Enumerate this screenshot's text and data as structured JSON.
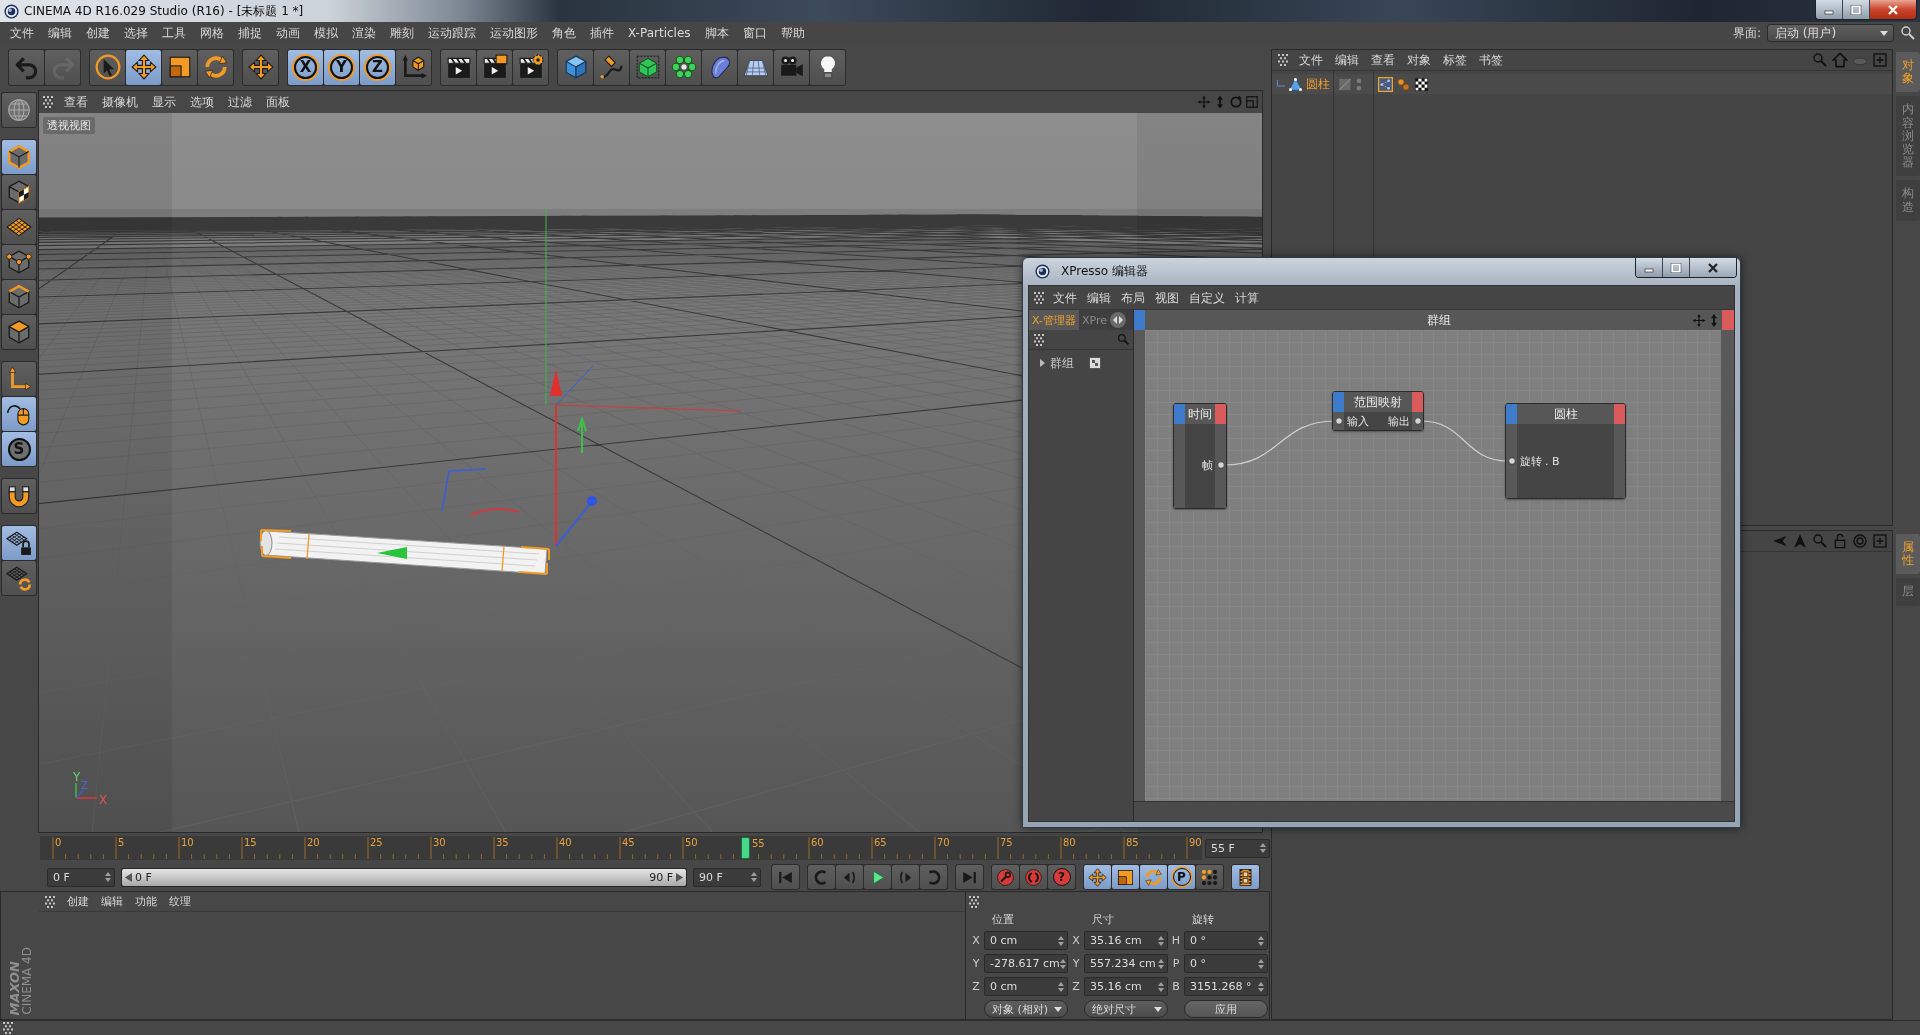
{
  "title_bar": {
    "title": "CINEMA 4D R16.029 Studio (R16) - [未标题 1 *]"
  },
  "menu_bar": {
    "items": [
      "文件",
      "编辑",
      "创建",
      "选择",
      "工具",
      "网格",
      "捕捉",
      "动画",
      "模拟",
      "渲染",
      "雕刻",
      "运动跟踪",
      "运动图形",
      "角色",
      "插件",
      "X-Particles",
      "脚本",
      "窗口",
      "帮助"
    ],
    "layout_label": "界面:",
    "layout_value": "启动 (用户)"
  },
  "toolbar": {
    "groups": [
      {
        "items": [
          {
            "kind": "undo",
            "on": false,
            "disabled": false
          },
          {
            "kind": "redo",
            "on": false,
            "disabled": true
          }
        ]
      },
      {
        "items": [
          {
            "kind": "select",
            "on": false,
            "disabled": false
          },
          {
            "kind": "move",
            "on": true,
            "disabled": false
          },
          {
            "kind": "scale",
            "on": false,
            "disabled": false
          },
          {
            "kind": "rotate",
            "on": false,
            "disabled": false
          }
        ]
      },
      {
        "items": [
          {
            "kind": "cross",
            "on": false,
            "disabled": false
          }
        ]
      },
      {
        "items": [
          {
            "kind": "axislock",
            "label": "X",
            "on": true,
            "disabled": false
          },
          {
            "kind": "axislock",
            "label": "Y",
            "on": true,
            "disabled": false
          },
          {
            "kind": "axislock",
            "label": "Z",
            "on": true,
            "disabled": false
          },
          {
            "kind": "coords",
            "on": false,
            "disabled": false
          }
        ]
      },
      {
        "items": [
          {
            "kind": "render",
            "on": false,
            "disabled": false
          },
          {
            "kind": "renderview",
            "on": false,
            "disabled": false
          },
          {
            "kind": "rendersettings",
            "on": false,
            "disabled": false
          }
        ]
      },
      {
        "items": [
          {
            "kind": "cube",
            "on": false,
            "disabled": false
          },
          {
            "kind": "pen",
            "on": false,
            "disabled": false
          },
          {
            "kind": "subdiv",
            "on": false,
            "disabled": false
          },
          {
            "kind": "cloner",
            "on": false,
            "disabled": false
          },
          {
            "kind": "bend",
            "on": false,
            "disabled": false
          },
          {
            "kind": "floor",
            "on": false,
            "disabled": false
          },
          {
            "kind": "camera",
            "on": false,
            "disabled": false
          },
          {
            "kind": "light",
            "on": false,
            "disabled": false
          }
        ]
      }
    ]
  },
  "tool_palette": {
    "groups": [
      {
        "items": [
          {
            "kind": "globe",
            "on": false
          }
        ]
      },
      {
        "items": [
          {
            "kind": "model",
            "on": true
          },
          {
            "kind": "texture",
            "on": false
          },
          {
            "kind": "workplane",
            "on": false
          },
          {
            "kind": "points",
            "on": false
          },
          {
            "kind": "edges",
            "on": false
          },
          {
            "kind": "polygons",
            "on": false
          }
        ]
      },
      {
        "items": [
          {
            "kind": "axis",
            "on": false
          },
          {
            "kind": "tweak",
            "on": true
          },
          {
            "kind": "solo",
            "label": "S",
            "on": true
          }
        ]
      },
      {
        "items": [
          {
            "kind": "magnet",
            "on": false
          }
        ]
      },
      {
        "items": [
          {
            "kind": "snaplock",
            "on": true
          },
          {
            "kind": "snaprotate",
            "on": false
          }
        ]
      }
    ]
  },
  "viewport": {
    "menu": [
      "查看",
      "摄像机",
      "显示",
      "选项",
      "过滤",
      "面板"
    ],
    "label": "透视视图",
    "axis_labels": [
      "Y",
      "Z",
      "X"
    ]
  },
  "timeline": {
    "ticks": [
      "0",
      "5",
      "10",
      "15",
      "20",
      "25",
      "30",
      "35",
      "40",
      "45",
      "50",
      "60",
      "65",
      "70",
      "75",
      "80",
      "85",
      "90"
    ],
    "playhead": {
      "label": "55",
      "level": 0.6111
    },
    "frame_field": "55 F"
  },
  "playback": {
    "start_field": "0 F",
    "range": {
      "start": "0 F",
      "end": "90 F",
      "level": 1
    },
    "end_field": "90 F",
    "groups": [
      {
        "items": [
          {
            "kind": "start",
            "on": false
          }
        ]
      },
      {
        "items": [
          {
            "kind": "prevkey",
            "on": false
          },
          {
            "kind": "prevframe",
            "on": false
          },
          {
            "kind": "play",
            "on": false
          },
          {
            "kind": "nextframe",
            "on": false
          },
          {
            "kind": "nextkey",
            "on": false
          }
        ]
      },
      {
        "items": [
          {
            "kind": "end",
            "on": false
          }
        ]
      },
      {
        "items": [
          {
            "kind": "record",
            "on": false
          },
          {
            "kind": "autokey",
            "on": false
          },
          {
            "kind": "keysel",
            "label": "?",
            "on": false
          }
        ]
      },
      {
        "items": [
          {
            "kind": "posrec",
            "on": true
          },
          {
            "kind": "scalerec",
            "on": true
          },
          {
            "kind": "rotrec",
            "on": true
          },
          {
            "kind": "param",
            "label": "P",
            "on": true
          },
          {
            "kind": "pla",
            "on": false
          }
        ]
      },
      {
        "items": [
          {
            "kind": "timeline",
            "on": true
          }
        ]
      }
    ]
  },
  "material_manager": {
    "menu": [
      "创建",
      "编辑",
      "功能",
      "纹理"
    ]
  },
  "logo": {
    "brand": "MAXON",
    "product": "CINEMA 4D"
  },
  "coordinates": {
    "headers": [
      "位置",
      "尺寸",
      "旋转"
    ],
    "rows": [
      {
        "cells": [
          {
            "axis": "X",
            "value": "0 cm"
          },
          {
            "axis": "X",
            "value": "35.16 cm"
          },
          {
            "axis": "H",
            "value": "0 °"
          }
        ]
      },
      {
        "cells": [
          {
            "axis": "Y",
            "value": "-278.617 cm"
          },
          {
            "axis": "Y",
            "value": "557.234 cm"
          },
          {
            "axis": "P",
            "value": "0 °"
          }
        ]
      },
      {
        "cells": [
          {
            "axis": "Z",
            "value": "0 cm"
          },
          {
            "axis": "Z",
            "value": "35.16 cm"
          },
          {
            "axis": "B",
            "value": "3151.268 °"
          }
        ]
      }
    ],
    "mode_dropdown": "对象 (相对)",
    "size_dropdown": "绝对尺寸",
    "apply_button": "应用"
  },
  "object_manager": {
    "menu": [
      "文件",
      "编辑",
      "查看",
      "对象",
      "标签",
      "书签"
    ],
    "objects": [
      {
        "name": "圆柱",
        "selected": true,
        "tags": [
          {
            "kind": "xpresso",
            "selected": true
          },
          {
            "kind": "vibrate",
            "selected": false
          },
          {
            "kind": "texture",
            "selected": false
          }
        ]
      }
    ]
  },
  "side_tabs": {
    "upper": [
      {
        "label": "对象",
        "selected": true
      },
      {
        "label": "内容浏览器",
        "selected": false
      },
      {
        "label": "构造",
        "selected": false
      }
    ],
    "lower": [
      {
        "label": "属性",
        "selected": true
      },
      {
        "label": "层",
        "selected": false
      }
    ]
  },
  "xpresso_editor": {
    "title": "XPresso 编辑器",
    "menu": [
      "文件",
      "编辑",
      "布局",
      "视图",
      "自定义",
      "计算"
    ],
    "tabs": [
      {
        "label": "X-管理器",
        "selected": true
      },
      {
        "label": "XPre",
        "selected": false
      }
    ],
    "tree": [
      {
        "name": "群组",
        "expanded": false
      }
    ],
    "graph": {
      "title": "群组",
      "nodes": [
        {
          "title": "时间",
          "outputs": [
            "帧"
          ]
        },
        {
          "title": "范围映射",
          "inputs": [
            "输入"
          ],
          "outputs": [
            "输出"
          ]
        },
        {
          "title": "圆柱",
          "inputs": [
            "旋转 . B"
          ]
        }
      ]
    }
  }
}
